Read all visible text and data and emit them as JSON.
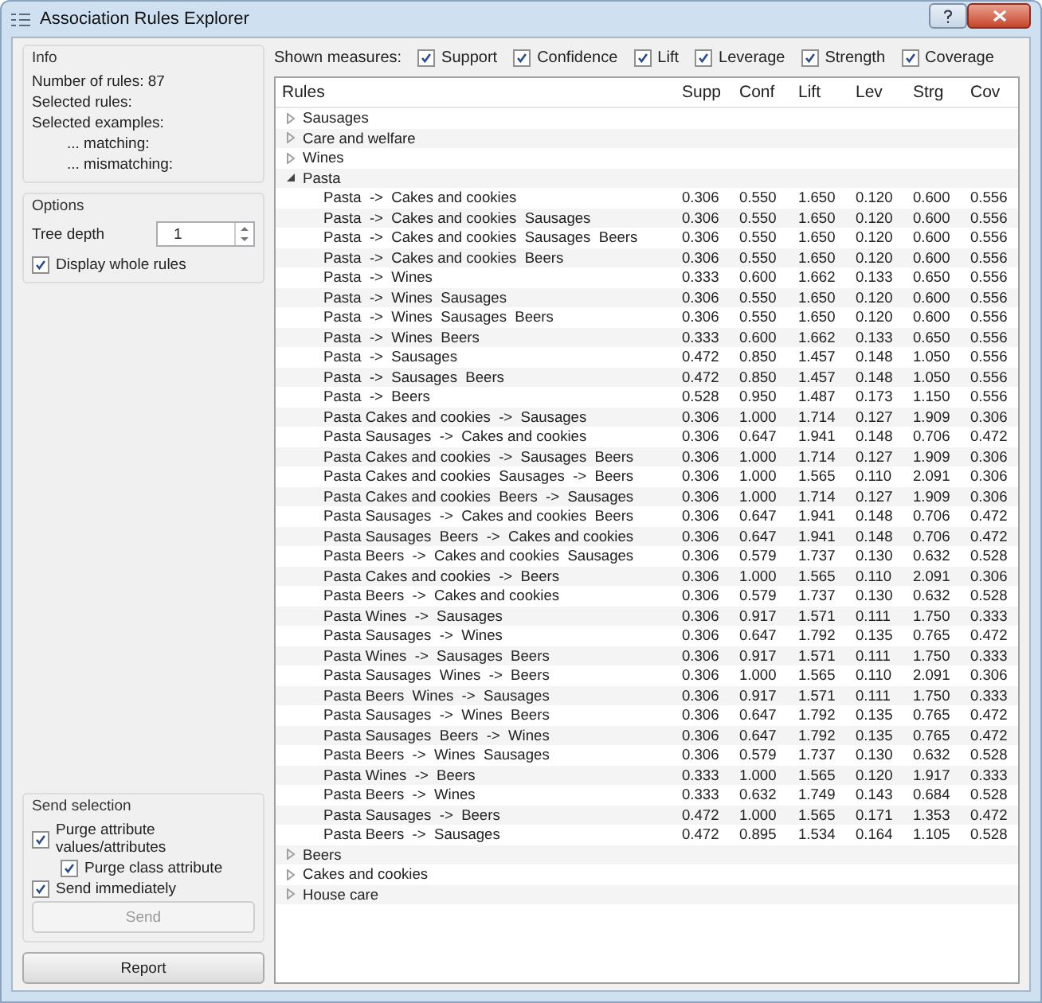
{
  "window": {
    "title": "Association Rules Explorer"
  },
  "info": {
    "title": "Info",
    "lines": [
      "Number of rules: 87",
      "Selected rules:",
      "Selected examples:"
    ],
    "sub_lines": [
      "... matching:",
      "... mismatching:"
    ]
  },
  "options": {
    "title": "Options",
    "tree_depth": {
      "label": "Tree depth",
      "value": "1"
    },
    "display_whole_rules": {
      "label": "Display whole rules",
      "checked": true
    }
  },
  "send_selection": {
    "title": "Send selection",
    "checkboxes": [
      {
        "label": "Purge attribute values/attributes",
        "checked": true,
        "children": [
          {
            "label": "Purge class attribute",
            "checked": true
          }
        ]
      },
      {
        "label": "Send immediately",
        "checked": true
      }
    ],
    "send_button": {
      "label": "Send",
      "disabled": true
    }
  },
  "report_button": "Report",
  "measures": {
    "label": "Shown measures:",
    "items": [
      {
        "label": "Support",
        "checked": true
      },
      {
        "label": "Confidence",
        "checked": true
      },
      {
        "label": "Lift",
        "checked": true
      },
      {
        "label": "Leverage",
        "checked": true
      },
      {
        "label": "Strength",
        "checked": true
      },
      {
        "label": "Coverage",
        "checked": true
      }
    ]
  },
  "table": {
    "columns": [
      "Rules",
      "Supp",
      "Conf",
      "Lift",
      "Lev",
      "Strg",
      "Cov"
    ],
    "rows": [
      {
        "label": "Sausages",
        "expanded": false
      },
      {
        "label": "Care and welfare",
        "expanded": false
      },
      {
        "label": "Wines",
        "expanded": false
      },
      {
        "label": "Pasta",
        "expanded": true,
        "children": [
          {
            "rule": "Pasta  ->  Cakes and cookies",
            "values": [
              "0.306",
              "0.550",
              "1.650",
              "0.120",
              "0.600",
              "0.556"
            ]
          },
          {
            "rule": "Pasta  ->  Cakes and cookies  Sausages",
            "values": [
              "0.306",
              "0.550",
              "1.650",
              "0.120",
              "0.600",
              "0.556"
            ]
          },
          {
            "rule": "Pasta  ->  Cakes and cookies  Sausages  Beers",
            "values": [
              "0.306",
              "0.550",
              "1.650",
              "0.120",
              "0.600",
              "0.556"
            ]
          },
          {
            "rule": "Pasta  ->  Cakes and cookies  Beers",
            "values": [
              "0.306",
              "0.550",
              "1.650",
              "0.120",
              "0.600",
              "0.556"
            ]
          },
          {
            "rule": "Pasta  ->  Wines",
            "values": [
              "0.333",
              "0.600",
              "1.662",
              "0.133",
              "0.650",
              "0.556"
            ]
          },
          {
            "rule": "Pasta  ->  Wines  Sausages",
            "values": [
              "0.306",
              "0.550",
              "1.650",
              "0.120",
              "0.600",
              "0.556"
            ]
          },
          {
            "rule": "Pasta  ->  Wines  Sausages  Beers",
            "values": [
              "0.306",
              "0.550",
              "1.650",
              "0.120",
              "0.600",
              "0.556"
            ]
          },
          {
            "rule": "Pasta  ->  Wines  Beers",
            "values": [
              "0.333",
              "0.600",
              "1.662",
              "0.133",
              "0.650",
              "0.556"
            ]
          },
          {
            "rule": "Pasta  ->  Sausages",
            "values": [
              "0.472",
              "0.850",
              "1.457",
              "0.148",
              "1.050",
              "0.556"
            ]
          },
          {
            "rule": "Pasta  ->  Sausages  Beers",
            "values": [
              "0.472",
              "0.850",
              "1.457",
              "0.148",
              "1.050",
              "0.556"
            ]
          },
          {
            "rule": "Pasta  ->  Beers",
            "values": [
              "0.528",
              "0.950",
              "1.487",
              "0.173",
              "1.150",
              "0.556"
            ]
          },
          {
            "rule": "Pasta Cakes and cookies  ->  Sausages",
            "values": [
              "0.306",
              "1.000",
              "1.714",
              "0.127",
              "1.909",
              "0.306"
            ]
          },
          {
            "rule": "Pasta Sausages  ->  Cakes and cookies",
            "values": [
              "0.306",
              "0.647",
              "1.941",
              "0.148",
              "0.706",
              "0.472"
            ]
          },
          {
            "rule": "Pasta Cakes and cookies  ->  Sausages  Beers",
            "values": [
              "0.306",
              "1.000",
              "1.714",
              "0.127",
              "1.909",
              "0.306"
            ]
          },
          {
            "rule": "Pasta Cakes and cookies  Sausages  ->  Beers",
            "values": [
              "0.306",
              "1.000",
              "1.565",
              "0.110",
              "2.091",
              "0.306"
            ]
          },
          {
            "rule": "Pasta Cakes and cookies  Beers  ->  Sausages",
            "values": [
              "0.306",
              "1.000",
              "1.714",
              "0.127",
              "1.909",
              "0.306"
            ]
          },
          {
            "rule": "Pasta Sausages  ->  Cakes and cookies  Beers",
            "values": [
              "0.306",
              "0.647",
              "1.941",
              "0.148",
              "0.706",
              "0.472"
            ]
          },
          {
            "rule": "Pasta Sausages  Beers  ->  Cakes and cookies",
            "values": [
              "0.306",
              "0.647",
              "1.941",
              "0.148",
              "0.706",
              "0.472"
            ]
          },
          {
            "rule": "Pasta Beers  ->  Cakes and cookies  Sausages",
            "values": [
              "0.306",
              "0.579",
              "1.737",
              "0.130",
              "0.632",
              "0.528"
            ]
          },
          {
            "rule": "Pasta Cakes and cookies  ->  Beers",
            "values": [
              "0.306",
              "1.000",
              "1.565",
              "0.110",
              "2.091",
              "0.306"
            ]
          },
          {
            "rule": "Pasta Beers  ->  Cakes and cookies",
            "values": [
              "0.306",
              "0.579",
              "1.737",
              "0.130",
              "0.632",
              "0.528"
            ]
          },
          {
            "rule": "Pasta Wines  ->  Sausages",
            "values": [
              "0.306",
              "0.917",
              "1.571",
              "0.111",
              "1.750",
              "0.333"
            ]
          },
          {
            "rule": "Pasta Sausages  ->  Wines",
            "values": [
              "0.306",
              "0.647",
              "1.792",
              "0.135",
              "0.765",
              "0.472"
            ]
          },
          {
            "rule": "Pasta Wines  ->  Sausages  Beers",
            "values": [
              "0.306",
              "0.917",
              "1.571",
              "0.111",
              "1.750",
              "0.333"
            ]
          },
          {
            "rule": "Pasta Sausages  Wines  ->  Beers",
            "values": [
              "0.306",
              "1.000",
              "1.565",
              "0.110",
              "2.091",
              "0.306"
            ]
          },
          {
            "rule": "Pasta Beers  Wines  ->  Sausages",
            "values": [
              "0.306",
              "0.917",
              "1.571",
              "0.111",
              "1.750",
              "0.333"
            ]
          },
          {
            "rule": "Pasta Sausages  ->  Wines  Beers",
            "values": [
              "0.306",
              "0.647",
              "1.792",
              "0.135",
              "0.765",
              "0.472"
            ]
          },
          {
            "rule": "Pasta Sausages  Beers  ->  Wines",
            "values": [
              "0.306",
              "0.647",
              "1.792",
              "0.135",
              "0.765",
              "0.472"
            ]
          },
          {
            "rule": "Pasta Beers  ->  Wines  Sausages",
            "values": [
              "0.306",
              "0.579",
              "1.737",
              "0.130",
              "0.632",
              "0.528"
            ]
          },
          {
            "rule": "Pasta Wines  ->  Beers",
            "values": [
              "0.333",
              "1.000",
              "1.565",
              "0.120",
              "1.917",
              "0.333"
            ]
          },
          {
            "rule": "Pasta Beers  ->  Wines",
            "values": [
              "0.333",
              "0.632",
              "1.749",
              "0.143",
              "0.684",
              "0.528"
            ]
          },
          {
            "rule": "Pasta Sausages  ->  Beers",
            "values": [
              "0.472",
              "1.000",
              "1.565",
              "0.171",
              "1.353",
              "0.472"
            ]
          },
          {
            "rule": "Pasta Beers  ->  Sausages",
            "values": [
              "0.472",
              "0.895",
              "1.534",
              "0.164",
              "1.105",
              "0.528"
            ]
          }
        ]
      },
      {
        "label": "Beers",
        "expanded": false
      },
      {
        "label": "Cakes and cookies",
        "expanded": false
      },
      {
        "label": "House care",
        "expanded": false
      }
    ]
  }
}
